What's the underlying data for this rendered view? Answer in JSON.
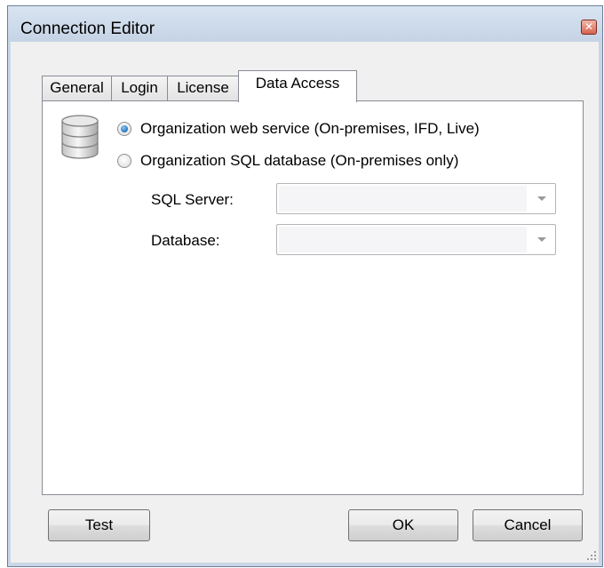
{
  "window": {
    "title": "Connection Editor",
    "close_glyph": "✕"
  },
  "tabs": [
    {
      "label": "General",
      "active": false
    },
    {
      "label": "Login",
      "active": false
    },
    {
      "label": "License",
      "active": false
    },
    {
      "label": "Data Access",
      "active": true
    }
  ],
  "data_access": {
    "icon": "database-icon",
    "options": [
      {
        "label": "Organization web service (On-premises, IFD, Live)",
        "checked": true
      },
      {
        "label": "Organization SQL database (On-premises only)",
        "checked": false
      }
    ],
    "sql_server": {
      "label": "SQL Server:",
      "value": ""
    },
    "database": {
      "label": "Database:",
      "value": ""
    }
  },
  "buttons": {
    "test": "Test",
    "ok": "OK",
    "cancel": "Cancel"
  },
  "colors": {
    "frame": "#c9d6e6",
    "radio_checked": "#2f7fc6",
    "panel": "#ffffff",
    "client": "#f0f0f0"
  }
}
